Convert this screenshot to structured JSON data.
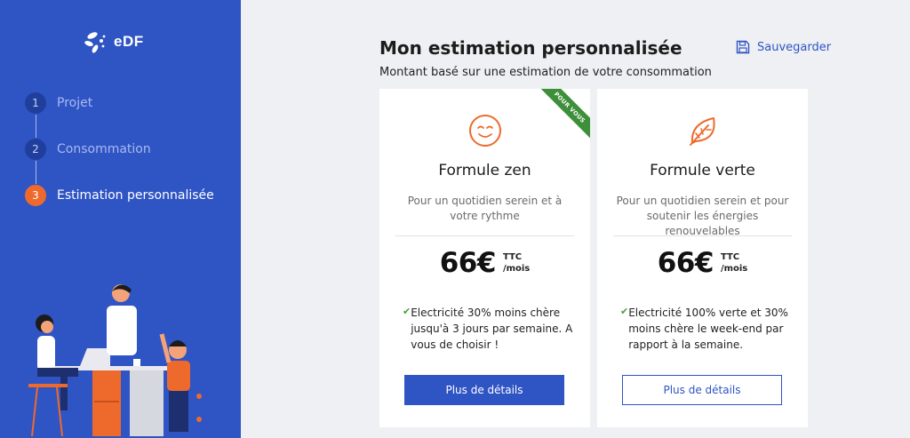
{
  "brand": {
    "logo_text": "eDF"
  },
  "sidebar": {
    "steps": [
      {
        "number": "1",
        "label": "Projet"
      },
      {
        "number": "2",
        "label": "Consommation"
      },
      {
        "number": "3",
        "label": "Estimation personnalisée"
      }
    ]
  },
  "header": {
    "title": "Mon estimation personnalisée",
    "subtitle": "Montant basé sur une estimation de votre consommation",
    "save_label": "Sauvegarder"
  },
  "offers": [
    {
      "ribbon": "POUR VOUS",
      "icon": "smiley-icon",
      "title": "Formule zen",
      "description": "Pour un quotidien serein et à votre rythme",
      "price": "66€",
      "price_ttc": "TTC",
      "price_period": "/mois",
      "feature": "Electricité 30% moins chère jusqu'à 3 jours par semaine. A vous de choisir !",
      "button": "Plus de détails"
    },
    {
      "icon": "leaf-icon",
      "title": "Formule verte",
      "description": "Pour un quotidien serein et pour soutenir les énergies renouvelables",
      "price": "66€",
      "price_ttc": "TTC",
      "price_period": "/mois",
      "feature": "Electricité 100% verte et 30% moins chère le week-end par rapport à la semaine.",
      "button": "Plus de détails"
    }
  ],
  "colors": {
    "primary": "#2f54c4",
    "accent": "#ee6a2c",
    "ribbon": "#3e8f3a"
  }
}
